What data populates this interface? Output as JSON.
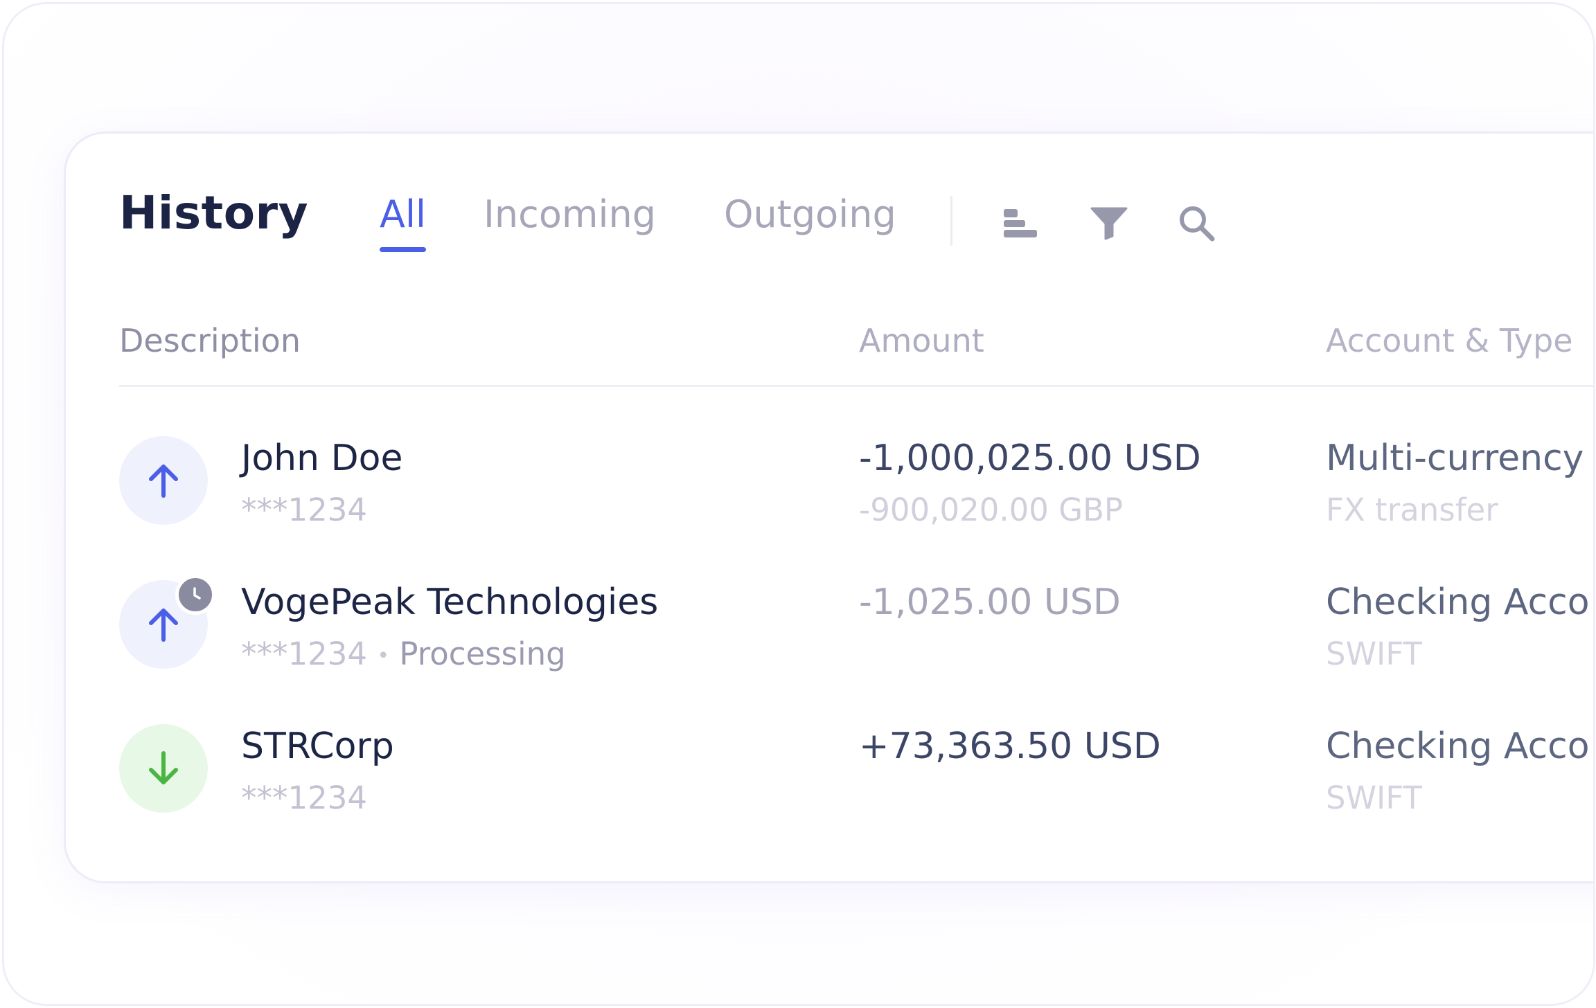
{
  "header": {
    "title": "History",
    "tabs": [
      {
        "label": "All",
        "active": true
      },
      {
        "label": "Incoming",
        "active": false
      },
      {
        "label": "Outgoing",
        "active": false
      }
    ],
    "tools": [
      "sort-icon",
      "filter-icon",
      "search-icon"
    ]
  },
  "table": {
    "columns": [
      "Description",
      "Amount",
      "Account & Type"
    ],
    "rows": [
      {
        "direction": "outgoing",
        "icon": "arrow-up-icon",
        "name": "John Doe",
        "account_mask": "***1234",
        "status": "",
        "amount": "-1,000,025.00 USD",
        "amount_secondary": "-900,020.00 GBP",
        "account": "Multi-currency",
        "type": "FX transfer"
      },
      {
        "direction": "outgoing",
        "icon": "arrow-up-icon",
        "pending_badge": "clock-icon",
        "name": "VogePeak Technologies",
        "account_mask": "***1234",
        "separator": "•",
        "status": "Processing",
        "amount": "-1,025.00 USD",
        "amount_secondary": "",
        "account": "Checking Acco",
        "type": "SWIFT"
      },
      {
        "direction": "incoming",
        "icon": "arrow-down-icon",
        "name": "STRCorp",
        "account_mask": "***1234",
        "status": "",
        "amount": "+73,363.50 USD",
        "amount_secondary": "",
        "account": "Checking Acco",
        "type": "SWIFT"
      }
    ]
  },
  "colors": {
    "accent": "#4b5ee6",
    "title": "#1c2445",
    "incoming": "#4bb543",
    "incoming_bg": "#e7f8e7",
    "outgoing_bg": "#eff1fd",
    "muted": "#a6a6b8"
  }
}
